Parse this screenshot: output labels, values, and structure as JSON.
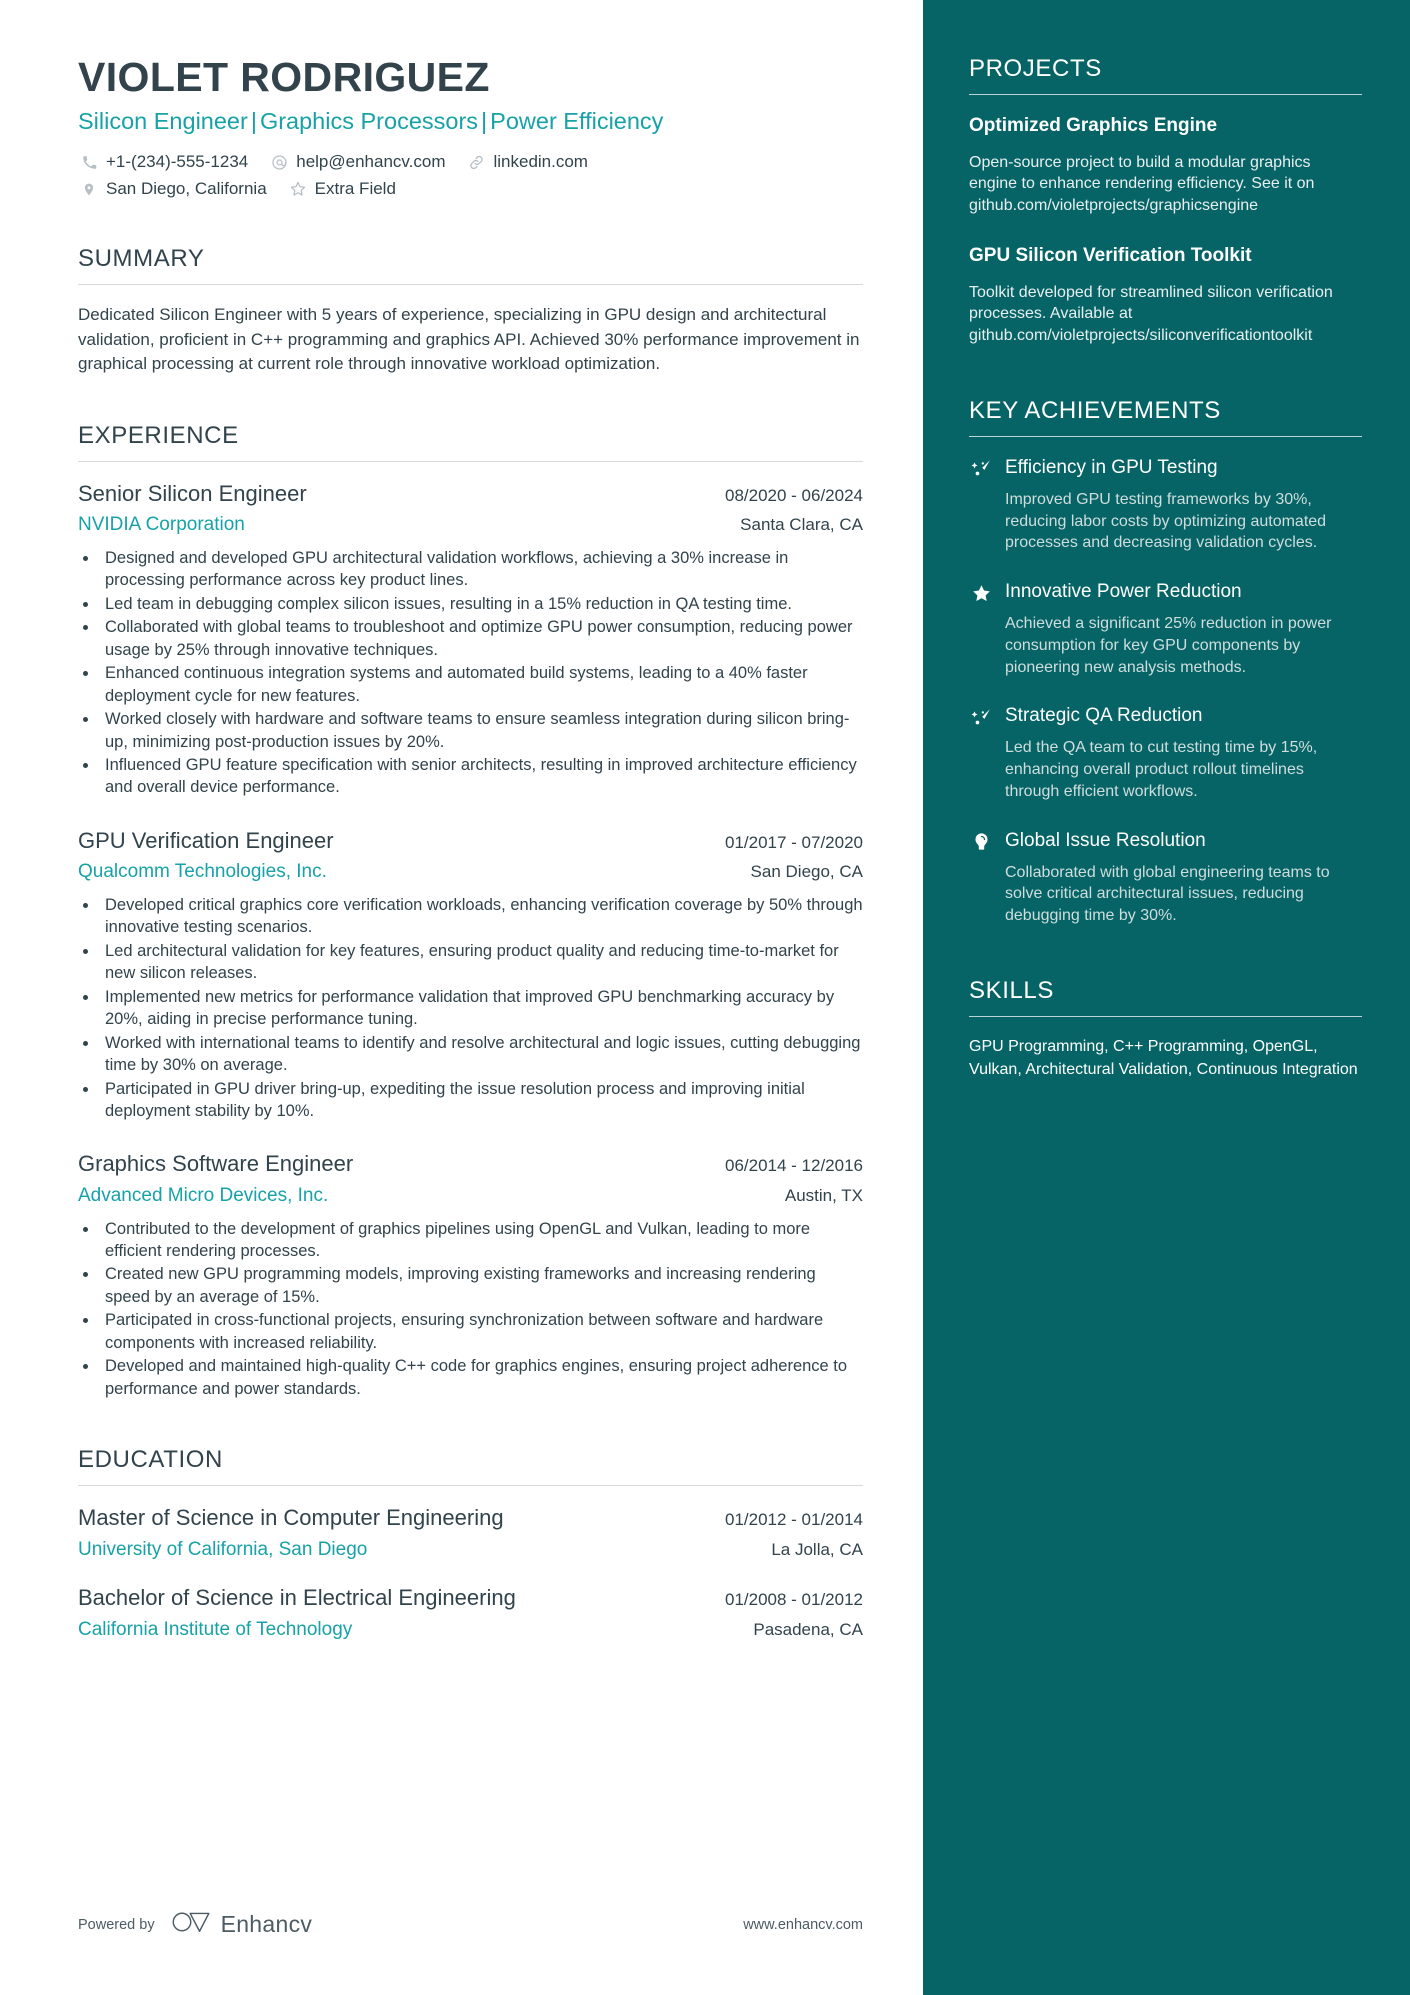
{
  "header": {
    "name": "VIOLET RODRIGUEZ",
    "headline_parts": [
      "Silicon Engineer",
      "Graphics Processors",
      "Power Efficiency"
    ],
    "separator": "|",
    "contacts_row1": [
      {
        "icon": "phone-icon",
        "text": "+1-(234)-555-1234"
      },
      {
        "icon": "email-icon",
        "text": "help@enhancv.com"
      },
      {
        "icon": "link-icon",
        "text": "linkedin.com"
      }
    ],
    "contacts_row2": [
      {
        "icon": "location-pin-icon",
        "text": "San Diego, California"
      },
      {
        "icon": "star-outline-icon",
        "text": "Extra Field"
      }
    ]
  },
  "summary": {
    "heading": "SUMMARY",
    "text": "Dedicated Silicon Engineer with 5 years of experience, specializing in GPU design and architectural validation, proficient in C++ programming and graphics API. Achieved 30% performance improvement in graphical processing at current role through innovative workload optimization."
  },
  "experience": {
    "heading": "EXPERIENCE",
    "entries": [
      {
        "title": "Senior Silicon Engineer",
        "date": "08/2020 - 06/2024",
        "organization": "NVIDIA Corporation",
        "location": "Santa Clara, CA",
        "bullets": [
          "Designed and developed GPU architectural validation workflows, achieving a 30% increase in processing performance across key product lines.",
          "Led team in debugging complex silicon issues, resulting in a 15% reduction in QA testing time.",
          "Collaborated with global teams to troubleshoot and optimize GPU power consumption, reducing power usage by 25% through innovative techniques.",
          "Enhanced continuous integration systems and automated build systems, leading to a 40% faster deployment cycle for new features.",
          "Worked closely with hardware and software teams to ensure seamless integration during silicon bring-up, minimizing post-production issues by 20%.",
          "Influenced GPU feature specification with senior architects, resulting in improved architecture efficiency and overall device performance."
        ]
      },
      {
        "title": "GPU Verification Engineer",
        "date": "01/2017 - 07/2020",
        "organization": "Qualcomm Technologies, Inc.",
        "location": "San Diego, CA",
        "bullets": [
          "Developed critical graphics core verification workloads, enhancing verification coverage by 50% through innovative testing scenarios.",
          "Led architectural validation for key features, ensuring product quality and reducing time-to-market for new silicon releases.",
          "Implemented new metrics for performance validation that improved GPU benchmarking accuracy by 20%, aiding in precise performance tuning.",
          "Worked with international teams to identify and resolve architectural and logic issues, cutting debugging time by 30% on average.",
          "Participated in GPU driver bring-up, expediting the issue resolution process and improving initial deployment stability by 10%."
        ]
      },
      {
        "title": "Graphics Software Engineer",
        "date": "06/2014 - 12/2016",
        "organization": "Advanced Micro Devices, Inc.",
        "location": "Austin, TX",
        "bullets": [
          "Contributed to the development of graphics pipelines using OpenGL and Vulkan, leading to more efficient rendering processes.",
          "Created new GPU programming models, improving existing frameworks and increasing rendering speed by an average of 15%.",
          "Participated in cross-functional projects, ensuring synchronization between software and hardware components with increased reliability.",
          "Developed and maintained high-quality C++ code for graphics engines, ensuring project adherence to performance and power standards."
        ]
      }
    ]
  },
  "education": {
    "heading": "EDUCATION",
    "entries": [
      {
        "title": "Master of Science in Computer Engineering",
        "date": "01/2012 - 01/2014",
        "organization": "University of California, San Diego",
        "location": "La Jolla, CA"
      },
      {
        "title": "Bachelor of Science in Electrical Engineering",
        "date": "01/2008 - 01/2012",
        "organization": "California Institute of Technology",
        "location": "Pasadena, CA"
      }
    ]
  },
  "projects": {
    "heading": "PROJECTS",
    "items": [
      {
        "title": "Optimized Graphics Engine",
        "description": "Open-source project to build a modular graphics engine to enhance rendering efficiency. See it on github.com/violetprojects/graphicsengine"
      },
      {
        "title": "GPU Silicon Verification Toolkit",
        "description": "Toolkit developed for streamlined silicon verification processes. Available at github.com/violetprojects/siliconverificationtoolkit"
      }
    ]
  },
  "key_achievements": {
    "heading": "KEY ACHIEVEMENTS",
    "items": [
      {
        "icon": "trend-arrow-icon",
        "title": "Efficiency in GPU Testing",
        "description": "Improved GPU testing frameworks by 30%, reducing labor costs by optimizing automated processes and decreasing validation cycles."
      },
      {
        "icon": "star-filled-icon",
        "title": "Innovative Power Reduction",
        "description": "Achieved a significant 25% reduction in power consumption for key GPU components by pioneering new analysis methods."
      },
      {
        "icon": "trend-arrow-icon",
        "title": "Strategic QA Reduction",
        "description": "Led the QA team to cut testing time by 15%, enhancing overall product rollout timelines through efficient workflows."
      },
      {
        "icon": "lightbulb-icon",
        "title": "Global Issue Resolution",
        "description": "Collaborated with global engineering teams to solve critical architectural issues, reducing debugging time by 30%."
      }
    ]
  },
  "skills": {
    "heading": "SKILLS",
    "text": "GPU Programming, C++ Programming, OpenGL, Vulkan, Architectural Validation, Continuous Integration"
  },
  "footer": {
    "powered_by": "Powered by",
    "brand": "Enhancv",
    "url": "www.enhancv.com"
  },
  "colors": {
    "accent_teal": "#17a2a8",
    "sidebar_bg": "#066466",
    "text_dark": "#32434c"
  }
}
